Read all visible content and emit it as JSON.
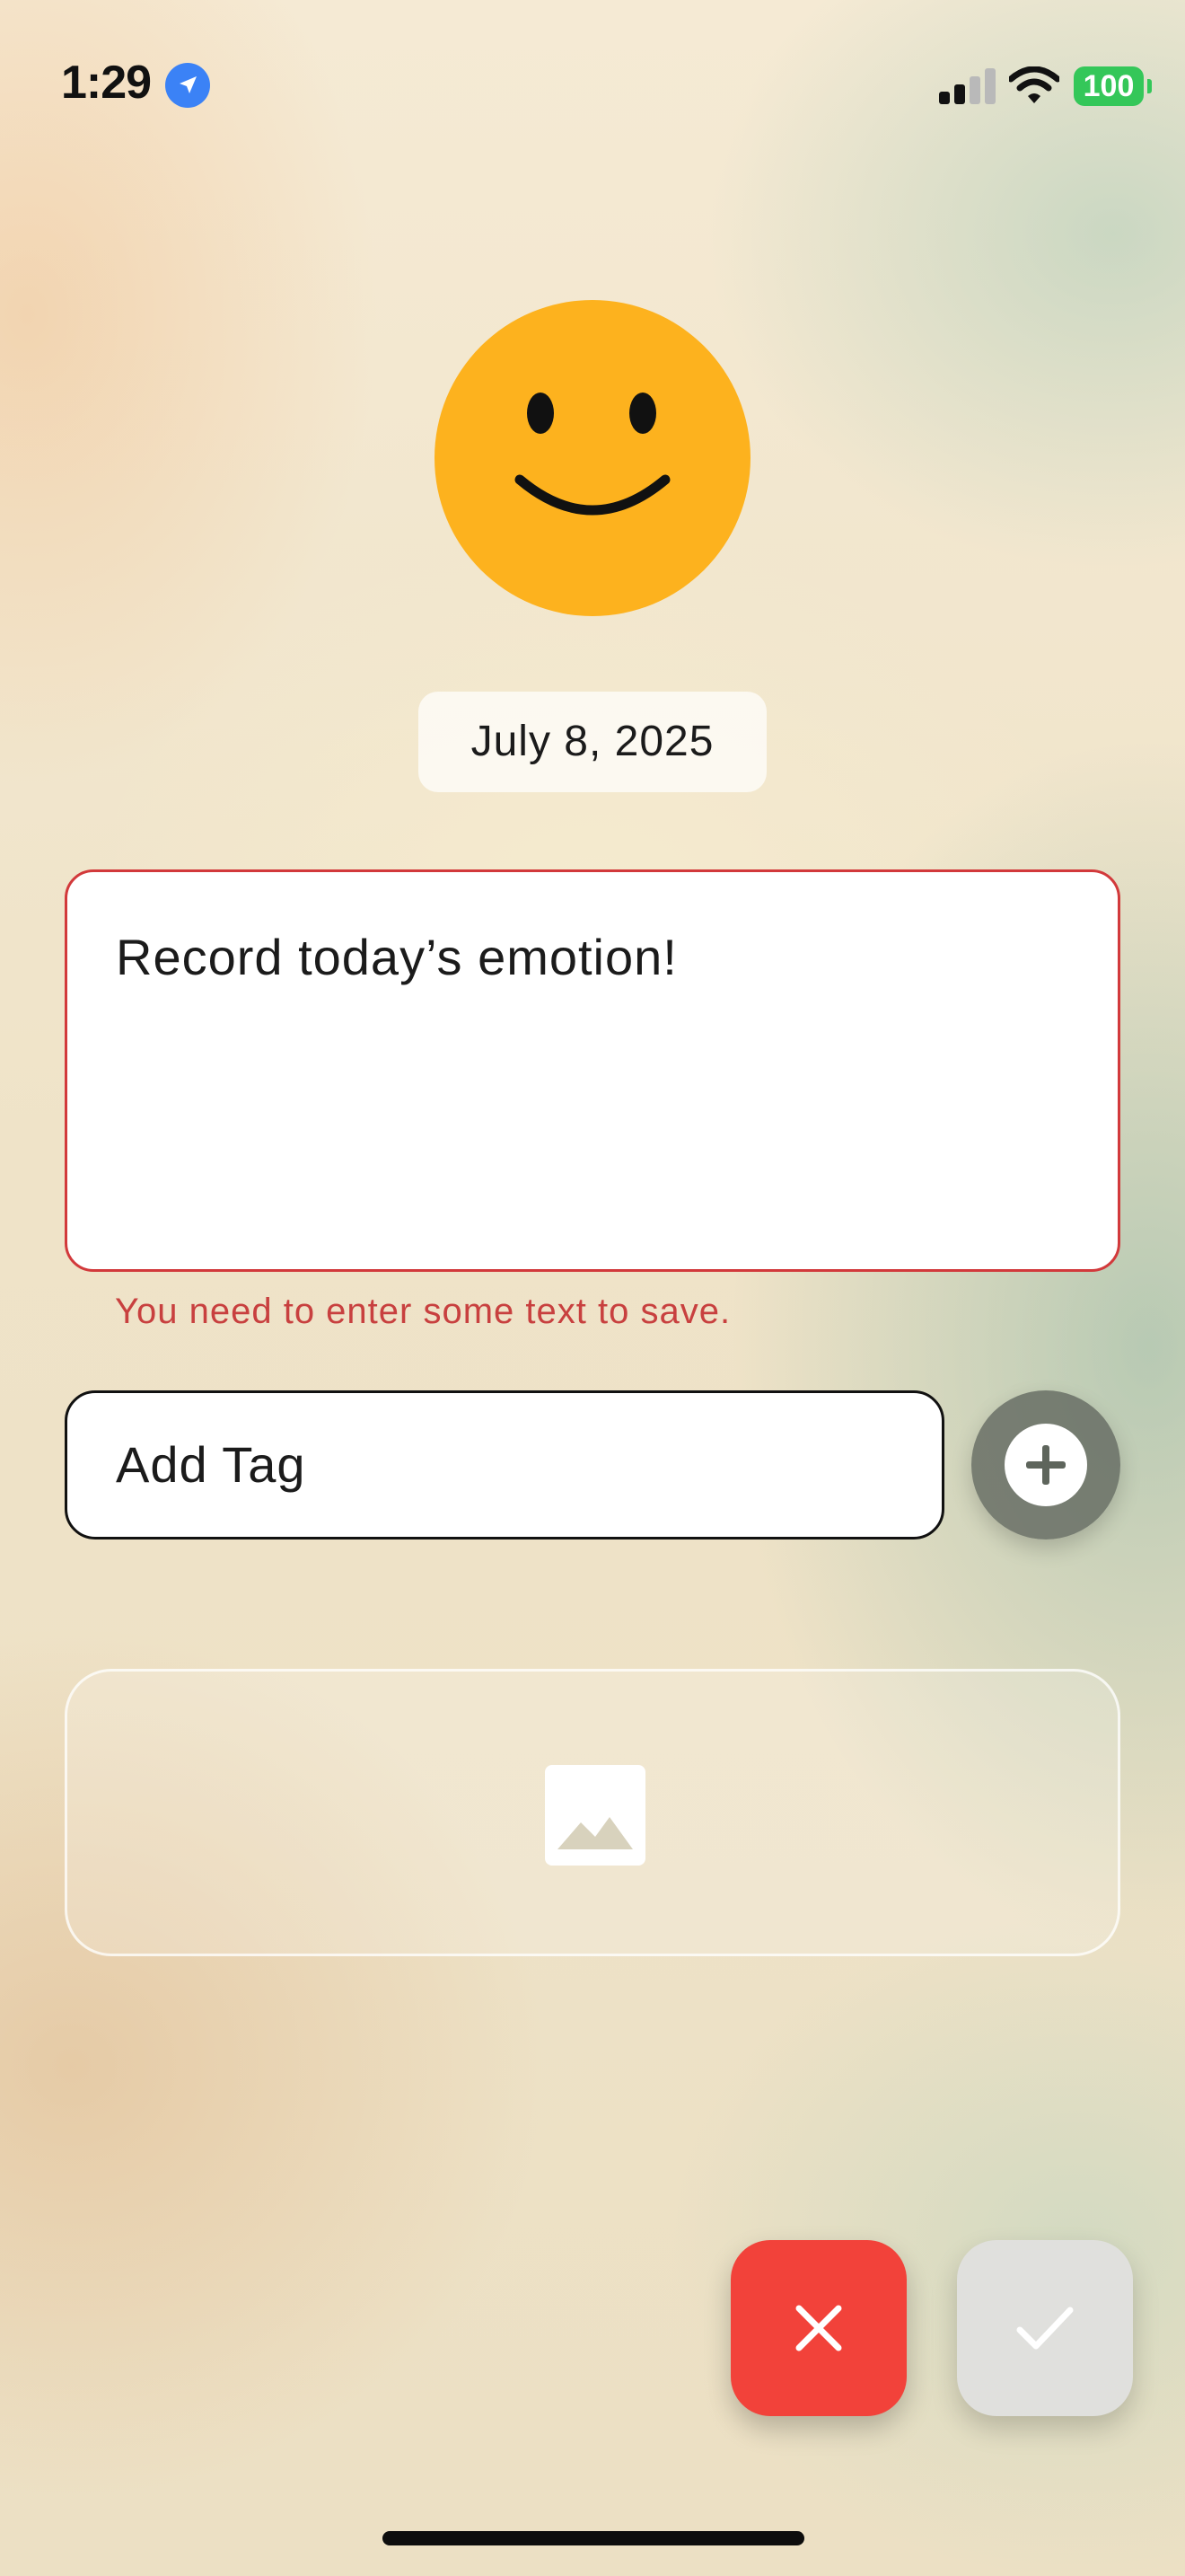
{
  "status_bar": {
    "time": "1:29",
    "battery": "100",
    "icons": [
      "location-arrow-icon",
      "cellular-signal-icon",
      "wifi-icon",
      "battery-icon"
    ]
  },
  "mood": {
    "icon": "smiley-face-icon",
    "color": "#fdb21e"
  },
  "entry": {
    "date": "July 8, 2025",
    "text_placeholder": "Record today’s emotion!",
    "error_message": "You need to enter some text to save.",
    "error_color": "#d2393b"
  },
  "tags": {
    "placeholder": "Add Tag",
    "add_button_icon": "plus-circle-icon"
  },
  "image_picker": {
    "icon": "image-icon"
  },
  "actions": {
    "cancel_icon": "close-icon",
    "cancel_color": "#f2423a",
    "confirm_icon": "checkmark-icon",
    "confirm_color": "#e0e0dd"
  }
}
